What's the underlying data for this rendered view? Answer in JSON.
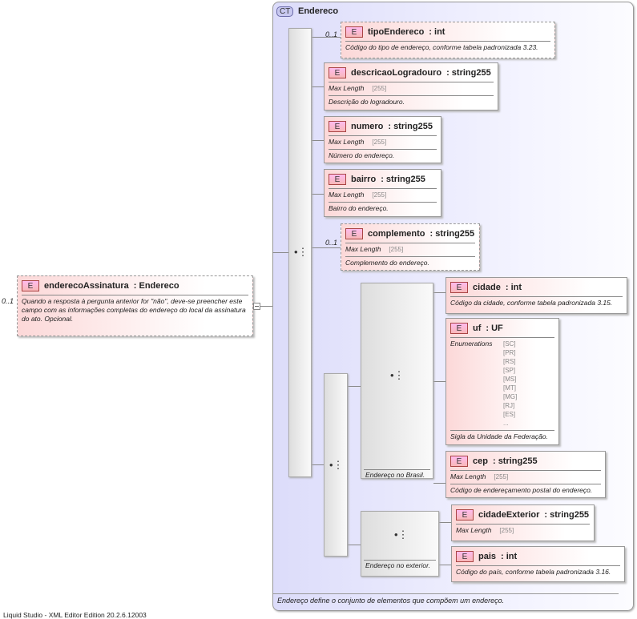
{
  "root": {
    "occurs": "0..1",
    "name": "enderecoAssinatura",
    "type": ": Endereco",
    "badge": "E",
    "doc": "Quando a resposta à pergunta anterior for \"não\", deve-se preencher este campo com as informações completas do endereço do local da assinatura do ato. Opcional."
  },
  "complex_type": {
    "badge": "CT",
    "name": "Endereco",
    "doc": "Endereço define o conjunto de elementos que compõem um endereço."
  },
  "elements": [
    {
      "occurs": "0..1",
      "name": "tipoEndereco",
      "type": ": int",
      "doc": "Código do tipo de endereço, conforme tabela padronizada 3.23."
    },
    {
      "name": "descricaoLogradouro",
      "type": ": string255",
      "facet": "Max Length",
      "facet_value": "[255]",
      "doc": "Descrição do logradouro."
    },
    {
      "name": "numero",
      "type": ": string255",
      "facet": "Max Length",
      "facet_value": "[255]",
      "doc": "Número do endereço."
    },
    {
      "name": "bairro",
      "type": ": string255",
      "facet": "Max Length",
      "facet_value": "[255]",
      "doc": "Bairro do endereço."
    },
    {
      "occurs": "0..1",
      "name": "complemento",
      "type": ": string255",
      "facet": "Max Length",
      "facet_value": "[255]",
      "doc": "Complemento do endereço."
    },
    {
      "name": "cidade",
      "type": ": int",
      "doc": "Código da cidade, conforme tabela padronizada 3.15."
    },
    {
      "name": "uf",
      "type": ": UF",
      "facet": "Enumerations",
      "enums": [
        "[SC]",
        "[PR]",
        "[RS]",
        "[SP]",
        "[MS]",
        "[MT]",
        "[MG]",
        "[RJ]",
        "[ES]",
        "..."
      ],
      "doc": "Sigla da Unidade da Federação."
    },
    {
      "name": "cep",
      "type": ": string255",
      "facet": "Max Length",
      "facet_value": "[255]",
      "doc": "Código de endereçamento postal do endereço."
    },
    {
      "name": "cidadeExterior",
      "type": ": string255",
      "facet": "Max Length",
      "facet_value": "[255]"
    },
    {
      "name": "pais",
      "type": ": int",
      "doc": "Código do país, conforme tabela padronizada 3.16."
    }
  ],
  "groups": {
    "brasil": "Endereço no Brasil.",
    "exterior": "Endereço no exterior."
  },
  "element_badge": "E",
  "footer": "Liquid Studio - XML Editor Edition 20.2.6.12003"
}
